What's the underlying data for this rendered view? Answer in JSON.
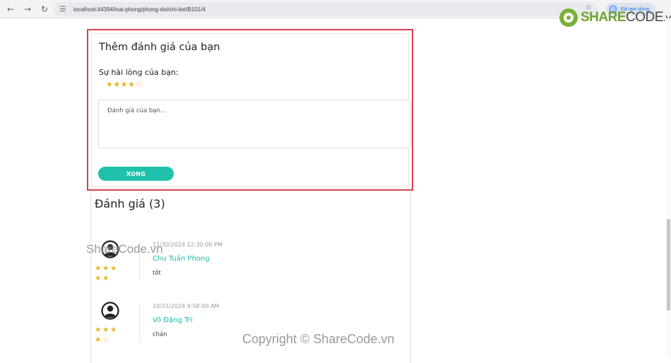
{
  "browser": {
    "url": "localhost:44394/loai-phong/phong-doi/chi-tiet/B101/4",
    "profile_initial": "Đ",
    "profile_status": "Đã tạm dừng"
  },
  "brand": {
    "name_strong": "SHARE",
    "name_light": "CODE",
    "domain": ".vn"
  },
  "review_form": {
    "title": "Thêm đánh giá của bạn",
    "satisfaction_label": "Sự hài lòng của bạn:",
    "rating": 4,
    "rating_max": 5,
    "comment_placeholder": "Đánh giá của bạn...",
    "submit_label": "XONG"
  },
  "reviews": {
    "heading": "Đánh giá (3)",
    "items": [
      {
        "date": "11/30/2024 12:30:00 PM",
        "name": "Chu Tuấn Phong",
        "comment": "tốt",
        "rating": 5
      },
      {
        "date": "10/21/2024 9:58:00 AM",
        "name": "Võ Đặng Trí",
        "comment": "chán",
        "rating": 4
      }
    ]
  },
  "watermarks": {
    "mid": "ShareCode.vn",
    "bottom": "Copyright © ShareCode.vn"
  },
  "colors": {
    "accent": "#1fc1ad",
    "star": "#e7b51f",
    "highlight_border": "#d9414a",
    "brand_green": "#6fa52f"
  }
}
